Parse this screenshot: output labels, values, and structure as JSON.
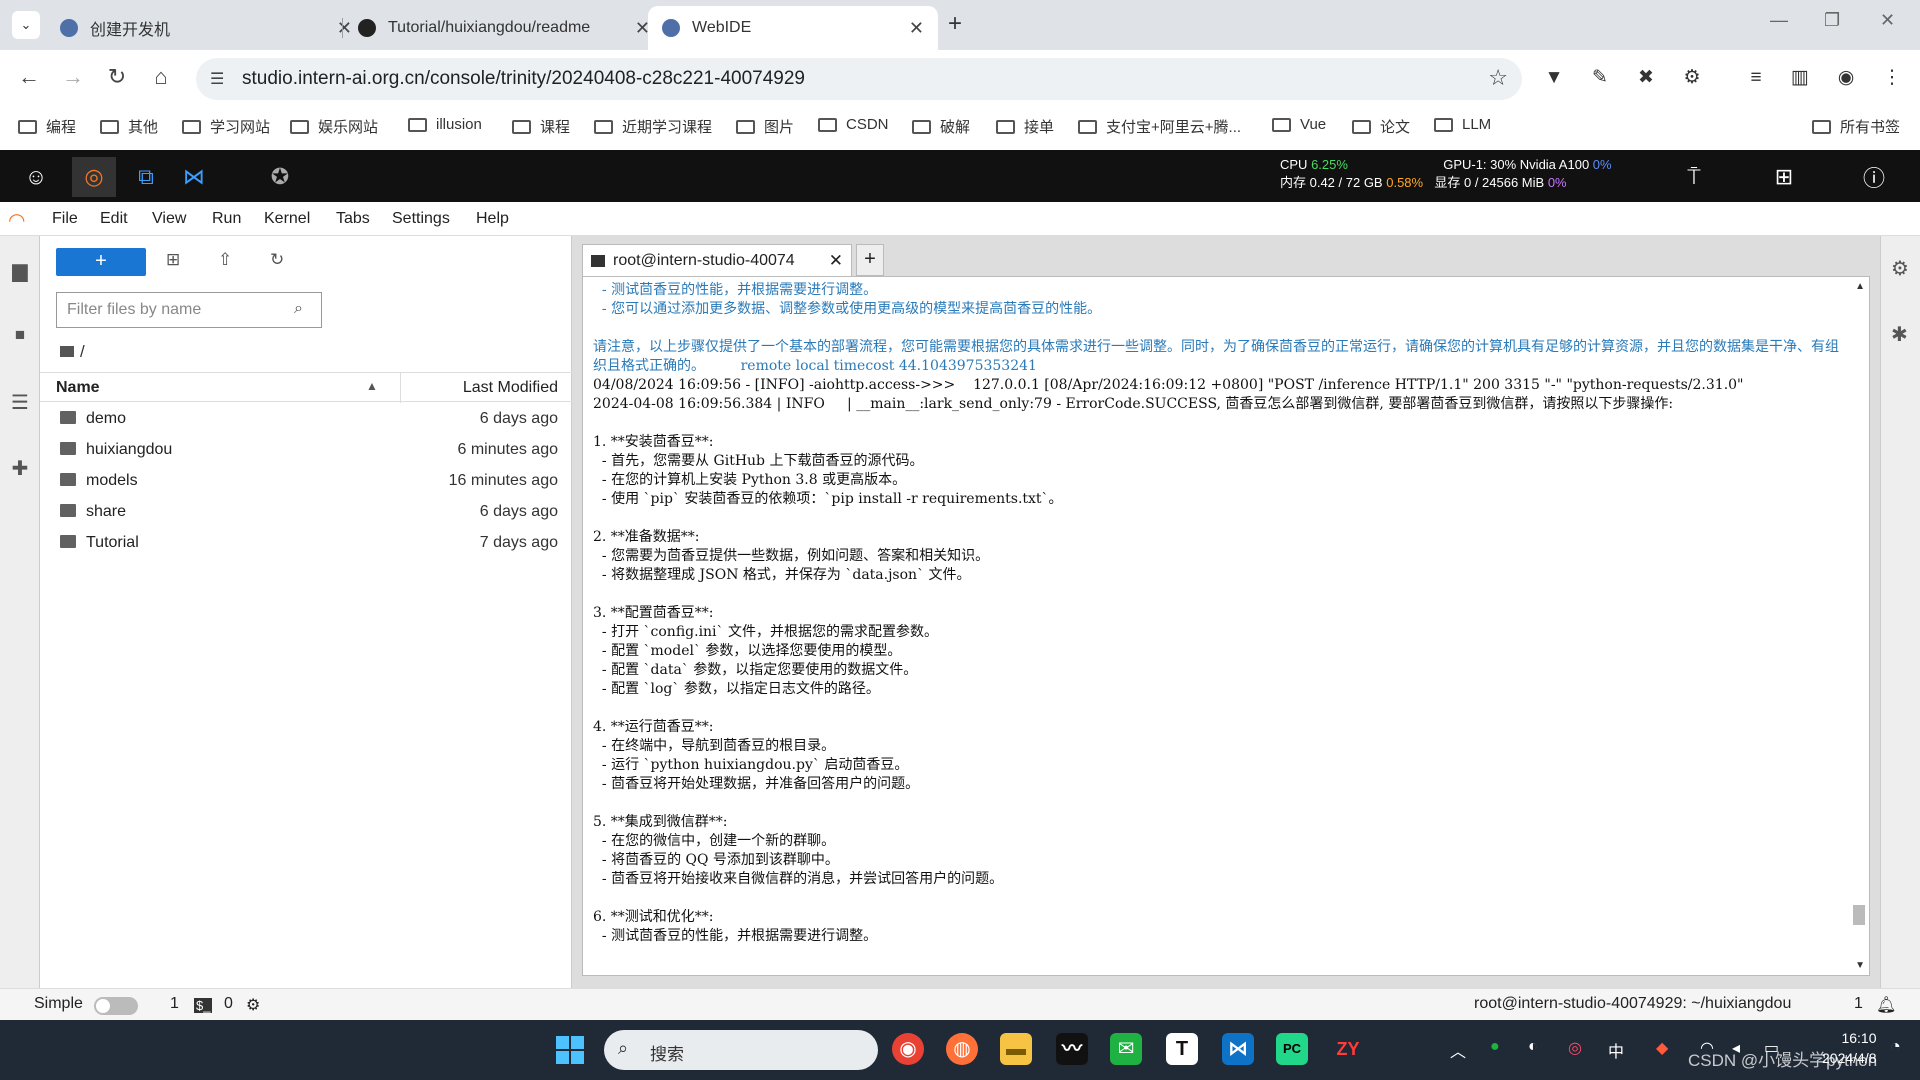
{
  "browser": {
    "tabs": [
      {
        "label": "创建开发机",
        "active": false
      },
      {
        "label": "Tutorial/huixiangdou/readme",
        "active": false
      },
      {
        "label": "WebIDE",
        "active": true
      }
    ],
    "url": "studio.intern-ai.org.cn/console/trinity/20240408-c28c221-40074929",
    "bookmarks": [
      "编程",
      "其他",
      "学习网站",
      "娱乐网站",
      "illusion",
      "课程",
      "近期学习课程",
      "图片",
      "CSDN",
      "破解",
      "接单",
      "支付宝+阿里云+腾...",
      "Vue",
      "论文",
      "LLM"
    ],
    "all_bookmarks": "所有书签"
  },
  "jupyter_top": {
    "cpu_label": "CPU",
    "cpu_value": "6.25%",
    "mem_label": "内存 0.42 / 72 GB",
    "mem_value": "0.58%",
    "gpu_label": "GPU-1: 30% Nvidia A100",
    "gpu_value": "0%",
    "vram_label": "显存 0 / 24566 MiB",
    "vram_value": "0%"
  },
  "menu": [
    "File",
    "Edit",
    "View",
    "Run",
    "Kernel",
    "Tabs",
    "Settings",
    "Help"
  ],
  "file_browser": {
    "new_button": "+",
    "filter_placeholder": "Filter files by name",
    "breadcrumb": "/",
    "col_name": "Name",
    "col_modified": "Last Modified",
    "rows": [
      {
        "name": "demo",
        "modified": "6 days ago"
      },
      {
        "name": "huixiangdou",
        "modified": "6 minutes ago"
      },
      {
        "name": "models",
        "modified": "16 minutes ago"
      },
      {
        "name": "share",
        "modified": "6 days ago"
      },
      {
        "name": "Tutorial",
        "modified": "7 days ago"
      }
    ]
  },
  "terminal": {
    "tab_title": "root@intern-studio-40074",
    "lines": [
      {
        "text": "  - 测试茴香豆的性能，并根据需要进行调整。",
        "color": "blue"
      },
      {
        "text": "  - 您可以通过添加更多数据、调整参数或使用更高级的模型来提高茴香豆的性能。",
        "color": "blue"
      },
      {
        "text": "",
        "color": ""
      },
      {
        "text": "请注意，以上步骤仅提供了一个基本的部署流程，您可能需要根据您的具体需求进行一些调整。同时，为了确保茴香豆的正常运行，请确保您的计算机具有足够的计算资源，并且您的数据集是干净、有组织且格式正确的。        remote local timecost 44.1043975353241",
        "color": "blue",
        "wrap": true
      },
      {
        "text": "04/08/2024 16:09:56 - [INFO] -aiohttp.access->>>    127.0.0.1 [08/Apr/2024:16:09:12 +0800] \"POST /inference HTTP/1.1\" 200 3315 \"-\" \"python-requests/2.31.0\"",
        "color": ""
      },
      {
        "text": "2024-04-08 16:09:56.384 | INFO     | __main__:lark_send_only:79 - ErrorCode.SUCCESS, 茴香豆怎么部署到微信群, 要部署茴香豆到微信群，请按照以下步骤操作:",
        "color": ""
      },
      {
        "text": "",
        "color": ""
      },
      {
        "text": "1. **安装茴香豆**:",
        "color": ""
      },
      {
        "text": "  - 首先，您需要从 GitHub 上下载茴香豆的源代码。",
        "color": ""
      },
      {
        "text": "  - 在您的计算机上安装 Python 3.8 或更高版本。",
        "color": ""
      },
      {
        "text": "  - 使用 `pip` 安装茴香豆的依赖项：`pip install -r requirements.txt`。",
        "color": ""
      },
      {
        "text": "",
        "color": ""
      },
      {
        "text": "2. **准备数据**:",
        "color": ""
      },
      {
        "text": "  - 您需要为茴香豆提供一些数据，例如问题、答案和相关知识。",
        "color": ""
      },
      {
        "text": "  - 将数据整理成 JSON 格式，并保存为 `data.json` 文件。",
        "color": ""
      },
      {
        "text": "",
        "color": ""
      },
      {
        "text": "3. **配置茴香豆**:",
        "color": ""
      },
      {
        "text": "  - 打开 `config.ini` 文件，并根据您的需求配置参数。",
        "color": ""
      },
      {
        "text": "  - 配置 `model` 参数，以选择您要使用的模型。",
        "color": ""
      },
      {
        "text": "  - 配置 `data` 参数，以指定您要使用的数据文件。",
        "color": ""
      },
      {
        "text": "  - 配置 `log` 参数，以指定日志文件的路径。",
        "color": ""
      },
      {
        "text": "",
        "color": ""
      },
      {
        "text": "4. **运行茴香豆**:",
        "color": ""
      },
      {
        "text": "  - 在终端中，导航到茴香豆的根目录。",
        "color": ""
      },
      {
        "text": "  - 运行 `python huixiangdou.py` 启动茴香豆。",
        "color": ""
      },
      {
        "text": "  - 茴香豆将开始处理数据，并准备回答用户的问题。",
        "color": ""
      },
      {
        "text": "",
        "color": ""
      },
      {
        "text": "5. **集成到微信群**:",
        "color": ""
      },
      {
        "text": "  - 在您的微信中，创建一个新的群聊。",
        "color": ""
      },
      {
        "text": "  - 将茴香豆的 QQ 号添加到该群聊中。",
        "color": ""
      },
      {
        "text": "  - 茴香豆将开始接收来自微信群的消息，并尝试回答用户的问题。",
        "color": ""
      },
      {
        "text": "",
        "color": ""
      },
      {
        "text": "6. **测试和优化**:",
        "color": ""
      },
      {
        "text": "  - 测试茴香豆的性能，并根据需要进行调整。",
        "color": ""
      }
    ]
  },
  "statusbar": {
    "mode": "Simple",
    "count1": "1",
    "count2": "0",
    "right_text": "root@intern-studio-40074929: ~/huixiangdou",
    "right_count": "1"
  },
  "taskbar": {
    "search_label": "搜索",
    "ime": "中",
    "time": "16:10",
    "date": "2024/4/8",
    "watermark": "CSDN @小馒头学python",
    "app_t": "T",
    "app_zy": "ZY",
    "app_pc": "PC"
  }
}
